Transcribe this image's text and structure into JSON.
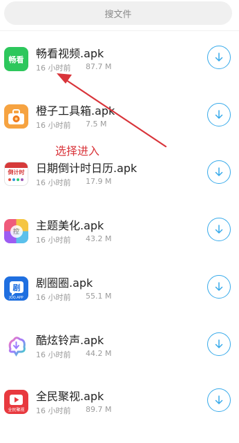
{
  "search": {
    "placeholder": "搜文件"
  },
  "files": [
    {
      "name": "畅看视频.apk",
      "time": "16 小时前",
      "size": "87.7 M",
      "icon": "changkan-video-app-icon",
      "icon_text": "畅看"
    },
    {
      "name": "橙子工具箱.apk",
      "time": "16 小时前",
      "size": "7.5 M",
      "icon": "orange-toolbox-app-icon"
    },
    {
      "name": "日期倒计时日历.apk",
      "time": "16 小时前",
      "size": "17.9 M",
      "icon": "countdown-calendar-app-icon",
      "icon_text": "倒计时"
    },
    {
      "name": "主题美化.apk",
      "time": "16 小时前",
      "size": "43.2 M",
      "icon": "theme-beautify-app-icon",
      "icon_text": "控"
    },
    {
      "name": "剧圈圈.apk",
      "time": "16 小时前",
      "size": "55.1 M",
      "icon": "juquanquan-app-icon",
      "icon_text": "JQQ.APP"
    },
    {
      "name": "酷炫铃声.apk",
      "time": "16 小时前",
      "size": "44.2 M",
      "icon": "cool-ringtone-app-icon"
    },
    {
      "name": "全民聚视.apk",
      "time": "16 小时前",
      "size": "89.7 M",
      "icon": "quanmin-jushi-app-icon",
      "icon_text": "全民聚视"
    }
  ],
  "annotation": {
    "text": "选择进入",
    "color": "#d9343a"
  },
  "colors": {
    "accent": "#35a9ea"
  }
}
